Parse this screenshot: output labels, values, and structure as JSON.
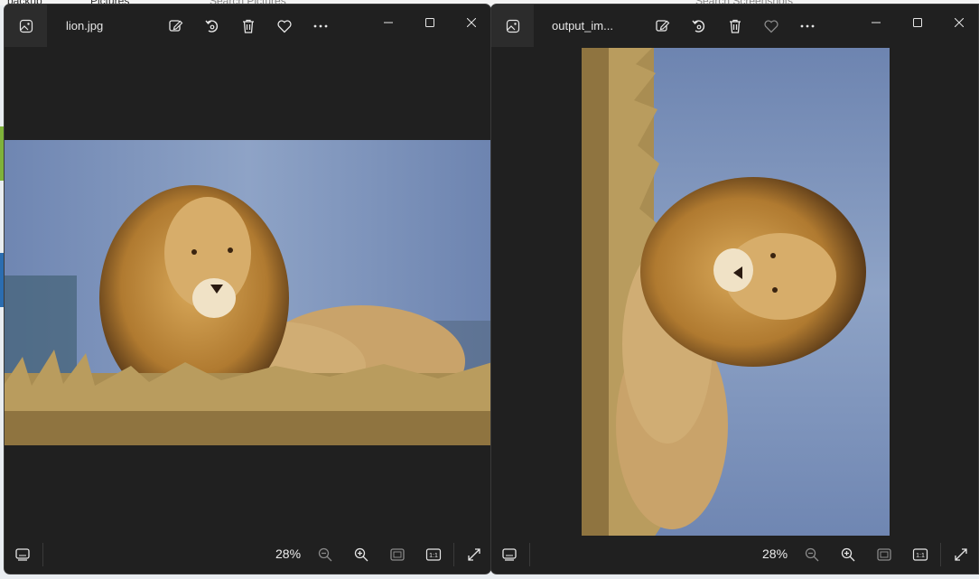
{
  "background": {
    "crumb_backup": "backup",
    "crumb_pictures": "Pictures",
    "search_left": "Search Pictures",
    "search_right": "Search Screenshots"
  },
  "windows": [
    {
      "id": "left",
      "title": "lion.jpg",
      "toolbar": [
        "edit-image-icon",
        "rotate-icon",
        "delete-icon",
        "favorite-icon",
        "more-options-icon"
      ],
      "zoom_level": "28%",
      "photo": {
        "description_subject": "lion",
        "orientation": "landscape"
      }
    },
    {
      "id": "right",
      "title": "output_im...",
      "toolbar": [
        "edit-image-icon",
        "rotate-icon",
        "delete-icon",
        "favorite-icon",
        "more-options-icon"
      ],
      "zoom_level": "28%",
      "photo": {
        "description_subject": "lion",
        "orientation": "rotated-90"
      }
    }
  ],
  "colors": {
    "window_bg": "#202020",
    "icon_fg": "#e6e6e6",
    "sky": "#7f94bd",
    "mane": "#b8873a",
    "grass": "#a58a4d"
  }
}
